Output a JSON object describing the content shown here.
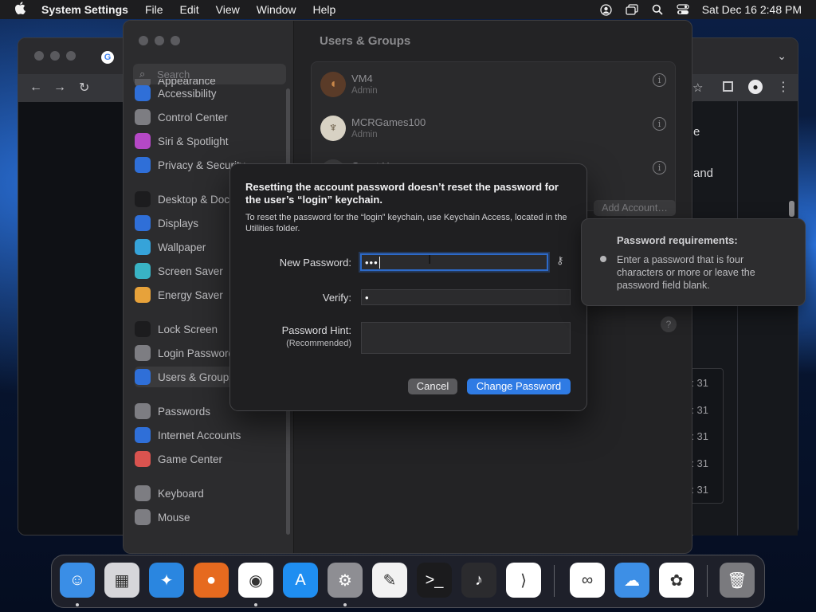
{
  "menubar": {
    "app_name": "System Settings",
    "menus": [
      "File",
      "Edit",
      "View",
      "Window",
      "Help"
    ],
    "clock": "Sat Dec 16  2:48 PM",
    "icons": [
      "apple-logo-icon",
      "user-circle-icon",
      "window-switcher-icon",
      "spotlight-search-icon",
      "control-center-icon"
    ]
  },
  "sidebar": {
    "search_placeholder": "Search",
    "items": [
      {
        "label": "Appearance",
        "icon": "appearance-icon",
        "color": "#5a5a5e"
      },
      {
        "label": "Accessibility",
        "icon": "accessibility-icon",
        "color": "#2f6fd8"
      },
      {
        "label": "Control Center",
        "icon": "control-center-icon",
        "color": "#7d7d82"
      },
      {
        "label": "Siri & Spotlight",
        "icon": "siri-icon",
        "color": "#b548c6"
      },
      {
        "label": "Privacy & Security",
        "icon": "hand-icon",
        "color": "#2f6fd8"
      },
      {
        "label": "Desktop & Dock",
        "icon": "dock-icon",
        "color": "#1c1c1e"
      },
      {
        "label": "Displays",
        "icon": "displays-icon",
        "color": "#2f6fd8"
      },
      {
        "label": "Wallpaper",
        "icon": "wallpaper-icon",
        "color": "#36a3d9"
      },
      {
        "label": "Screen Saver",
        "icon": "screen-saver-icon",
        "color": "#39b3c4"
      },
      {
        "label": "Energy Saver",
        "icon": "battery-icon",
        "color": "#e7a23a"
      },
      {
        "label": "Lock Screen",
        "icon": "lock-icon",
        "color": "#1c1c1e"
      },
      {
        "label": "Login Password",
        "icon": "login-password-icon",
        "color": "#7d7d82"
      },
      {
        "label": "Users & Groups",
        "icon": "users-icon",
        "color": "#2f6fd8"
      },
      {
        "label": "Passwords",
        "icon": "key-icon",
        "color": "#7d7d82"
      },
      {
        "label": "Internet Accounts",
        "icon": "at-icon",
        "color": "#2f6fd8"
      },
      {
        "label": "Game Center",
        "icon": "game-center-icon",
        "color": "#d9534f"
      },
      {
        "label": "Keyboard",
        "icon": "keyboard-icon",
        "color": "#7d7d82"
      },
      {
        "label": "Mouse",
        "icon": "mouse-icon",
        "color": "#7d7d82"
      }
    ]
  },
  "content": {
    "title": "Users & Groups",
    "users": [
      {
        "name": "VM4",
        "role": "Admin",
        "avatar": "football-avatar-icon"
      },
      {
        "name": "MCRGames100",
        "role": "Admin",
        "avatar": "eagle-avatar-icon"
      },
      {
        "name": "Guest User",
        "role": "",
        "avatar": "guest-avatar-icon"
      }
    ],
    "add_account_label": "Add Account…",
    "help_label": "?"
  },
  "chrome_bg": {
    "text_1": "e",
    "text_2": "and",
    "dates": [
      ": 31",
      ": 31",
      ": 31",
      ": 31",
      ": 31"
    ]
  },
  "dialog": {
    "headline": "Resetting the account password doesn’t reset the password for the user’s “login” keychain.",
    "description": "To reset the password for the “login” keychain, use Keychain Access, located in the Utilities folder.",
    "new_password_label": "New Password:",
    "new_password_value": "•••",
    "verify_label": "Verify:",
    "verify_value": "•",
    "hint_label": "Password Hint:",
    "hint_sublabel": "(Recommended)",
    "hint_value": "",
    "cancel_label": "Cancel",
    "change_label": "Change Password"
  },
  "tooltip": {
    "title": "Password requirements:",
    "text": "Enter a password that is four characters or more or leave the password field blank."
  },
  "dock": {
    "apps": [
      {
        "name": "finder-icon",
        "color": "#3a8ee6",
        "glyph": "☺"
      },
      {
        "name": "launchpad-icon",
        "color": "#d6d6da",
        "glyph": "▦"
      },
      {
        "name": "safari-icon",
        "color": "#2a86e0",
        "glyph": "✦"
      },
      {
        "name": "firefox-icon",
        "color": "#e66a1f",
        "glyph": "●"
      },
      {
        "name": "chrome-icon",
        "color": "#ffffff",
        "glyph": "◉"
      },
      {
        "name": "app-store-icon",
        "color": "#1f8ef1",
        "glyph": "A"
      },
      {
        "name": "system-settings-icon",
        "color": "#8e8e93",
        "glyph": "⚙"
      },
      {
        "name": "textedit-icon",
        "color": "#f2f2f2",
        "glyph": "✎"
      },
      {
        "name": "terminal-icon",
        "color": "#1b1b1d",
        "glyph": ">_"
      },
      {
        "name": "garageband-icon",
        "color": "#2b2b2e",
        "glyph": "♪"
      },
      {
        "name": "vscode-icon",
        "color": "#ffffff",
        "glyph": "⟩"
      },
      {
        "name": "visual-studio-icon",
        "color": "#ffffff",
        "glyph": "∞"
      },
      {
        "name": "weather-icon",
        "color": "#3d8fe6",
        "glyph": "☁"
      },
      {
        "name": "photos-icon",
        "color": "#ffffff",
        "glyph": "✿"
      },
      {
        "name": "trash-icon",
        "color": "#7a7a7e",
        "glyph": "🗑"
      }
    ]
  }
}
